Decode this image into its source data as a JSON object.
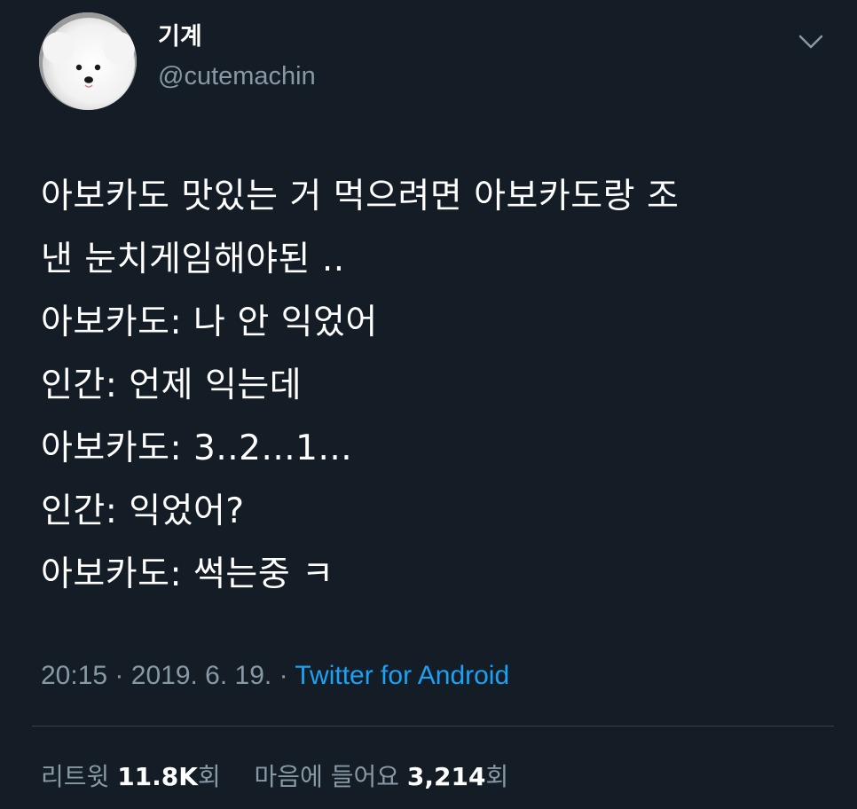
{
  "user": {
    "display_name": "기계",
    "handle": "@cutemachin",
    "avatar_icon": "white-dog-avatar"
  },
  "tweet": {
    "lines": [
      "아보카도 맛있는 거 먹으려면 아보카도랑 조",
      "낸 눈치게임해야된 ..",
      "아보카도: 나 안 익었어",
      "인간: 언제 익는데",
      "아보카도: 3..2...1...",
      "인간: 익었어?",
      "아보카도: 썩는중 ㅋ"
    ],
    "time": "20:15",
    "separator": "·",
    "date": "2019. 6. 19.",
    "source": "Twitter for Android"
  },
  "stats": {
    "retweet_label": "리트윗",
    "retweet_count": "11.8K",
    "retweet_suffix": "회",
    "like_label": "마음에 들어요",
    "like_count": "3,214",
    "like_suffix": "회"
  },
  "colors": {
    "background": "#141c26",
    "secondary_text": "#8899a6",
    "link": "#1da1f2",
    "divider": "#38444d"
  }
}
